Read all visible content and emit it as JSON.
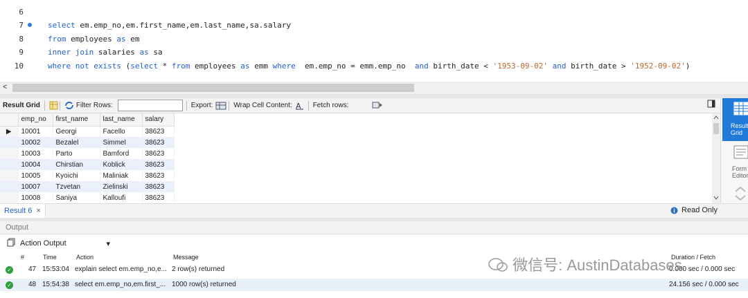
{
  "editor": {
    "lines": [
      {
        "n": "6",
        "t": ""
      },
      {
        "n": "7"
      },
      {
        "n": "8"
      },
      {
        "n": "9"
      },
      {
        "n": "10"
      }
    ],
    "l7": [
      "select",
      "em.emp_no,em.first_name,em.last_name,sa.salary"
    ],
    "l8": [
      "from",
      "employees",
      "as",
      "em"
    ],
    "l9": [
      "inner join",
      "salaries",
      "as",
      "sa"
    ],
    "l10": [
      "where not exists",
      "(",
      "select",
      "*",
      "from",
      "employees",
      "as",
      "emm",
      "where",
      "em.emp_no = emm.emp_no",
      "and",
      "birth_date <",
      "'1953-09-02'",
      "and",
      "birth_date >",
      "'1952-09-02'",
      ")"
    ]
  },
  "toolbar": {
    "result_grid": "Result Grid",
    "filter_rows": "Filter Rows:",
    "export": "Export:",
    "wrap": "Wrap Cell Content:",
    "fetch": "Fetch rows:"
  },
  "grid": {
    "columns": [
      "emp_no",
      "first_name",
      "last_name",
      "salary"
    ],
    "rows": [
      [
        "10001",
        "Georgi",
        "Facello",
        "38623"
      ],
      [
        "10002",
        "Bezalel",
        "Simmel",
        "38623"
      ],
      [
        "10003",
        "Parto",
        "Bamford",
        "38623"
      ],
      [
        "10004",
        "Chirstian",
        "Koblick",
        "38623"
      ],
      [
        "10005",
        "Kyoichi",
        "Maliniak",
        "38623"
      ],
      [
        "10007",
        "Tzvetan",
        "Zielinski",
        "38623"
      ],
      [
        "10008",
        "Saniya",
        "Kalloufi",
        "38623"
      ]
    ]
  },
  "side": {
    "result": "Result Grid",
    "form": "Form Editor"
  },
  "tabs": {
    "result6": "Result 6",
    "close": "×",
    "readonly": "Read Only"
  },
  "output": {
    "header": "Output",
    "action_output": "Action Output",
    "columns": [
      "#",
      "Time",
      "Action",
      "Message",
      "Duration / Fetch"
    ],
    "rows": [
      {
        "n": "47",
        "time": "15:53:04",
        "action": "explain select em.emp_no,e...",
        "message": "2 row(s) returned",
        "duration": "0.000 sec / 0.000 sec"
      },
      {
        "n": "48",
        "time": "15:54:38",
        "action": "select em.emp_no,em.first_...",
        "message": "1000 row(s) returned",
        "duration": "24.156 sec / 0.000 sec"
      }
    ]
  },
  "watermark": "微信号: AustinDatabases",
  "colors": {
    "keyword": "#2060d0",
    "string": "#b8682f",
    "accent": "#1f7ad8",
    "ok": "#2f9e3e"
  }
}
